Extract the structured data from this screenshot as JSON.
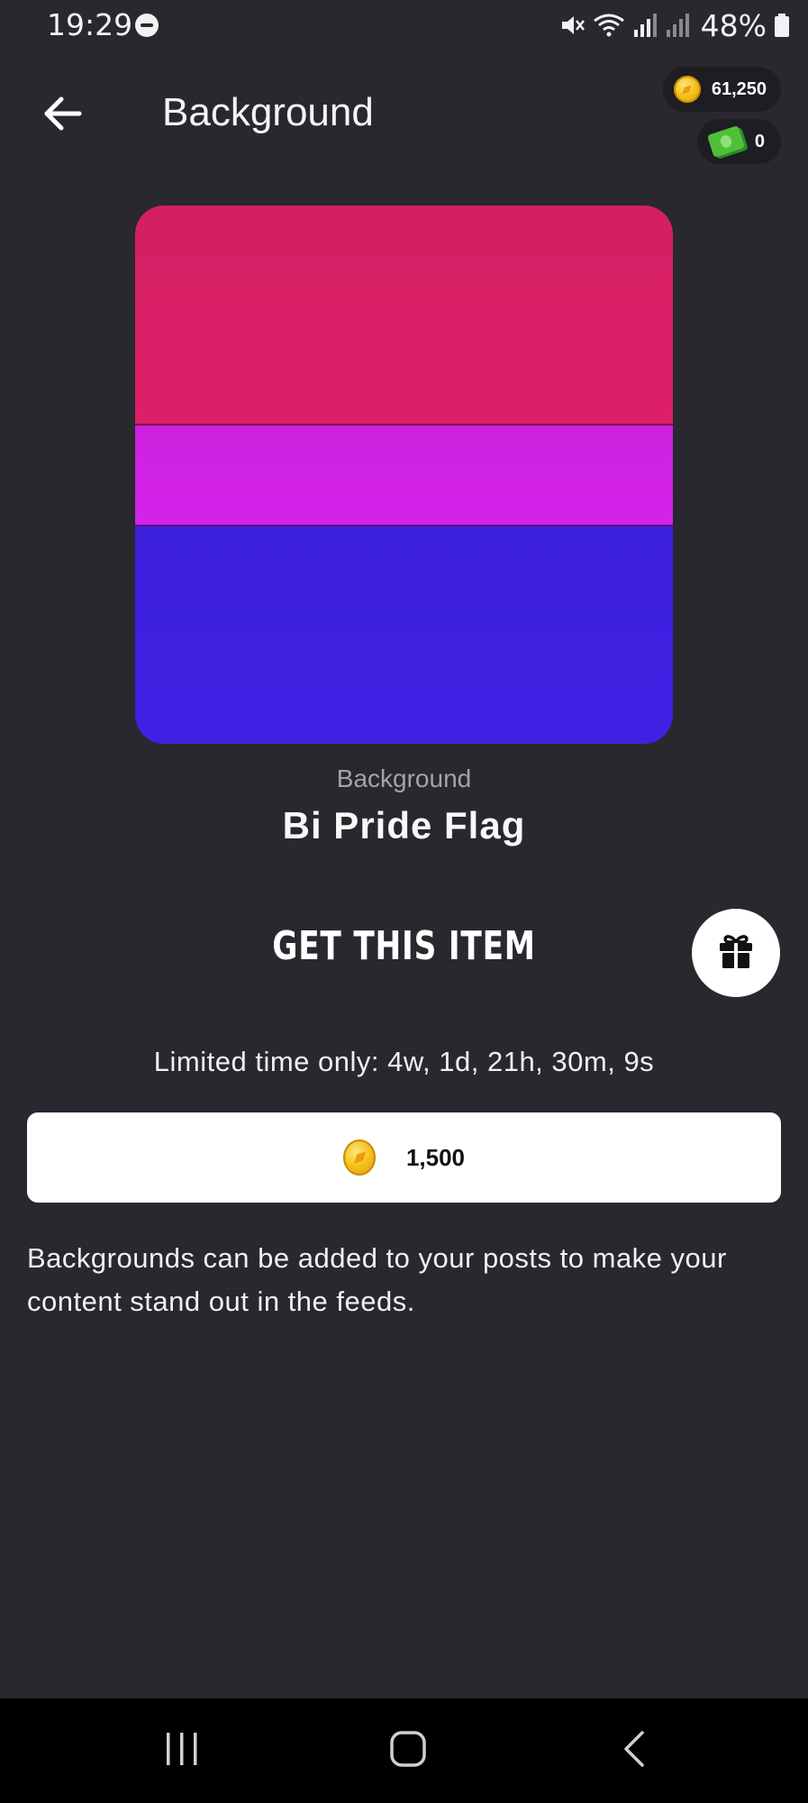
{
  "status_bar": {
    "time": "19:29",
    "battery": "48%"
  },
  "header": {
    "title": "Background",
    "coins": "61,250",
    "cash": "0"
  },
  "item": {
    "category": "Background",
    "name": "Bi Pride Flag",
    "flag_colors": [
      "#d6205f",
      "#d123e6",
      "#3c20df"
    ]
  },
  "purchase": {
    "heading": "GET THIS ITEM",
    "limited_text": "Limited time only: 4w, 1d, 21h, 30m, 9s",
    "price": "1,500",
    "description": "Backgrounds can be added to your posts to make your content stand out in the feeds."
  },
  "icons": {
    "back": "arrow-left-icon",
    "gift": "gift-icon",
    "coin": "coin-icon",
    "cash": "cash-icon"
  },
  "colors": {
    "background": "#28282e",
    "pill_background": "#1d1d22",
    "button_background": "#ffffff"
  }
}
